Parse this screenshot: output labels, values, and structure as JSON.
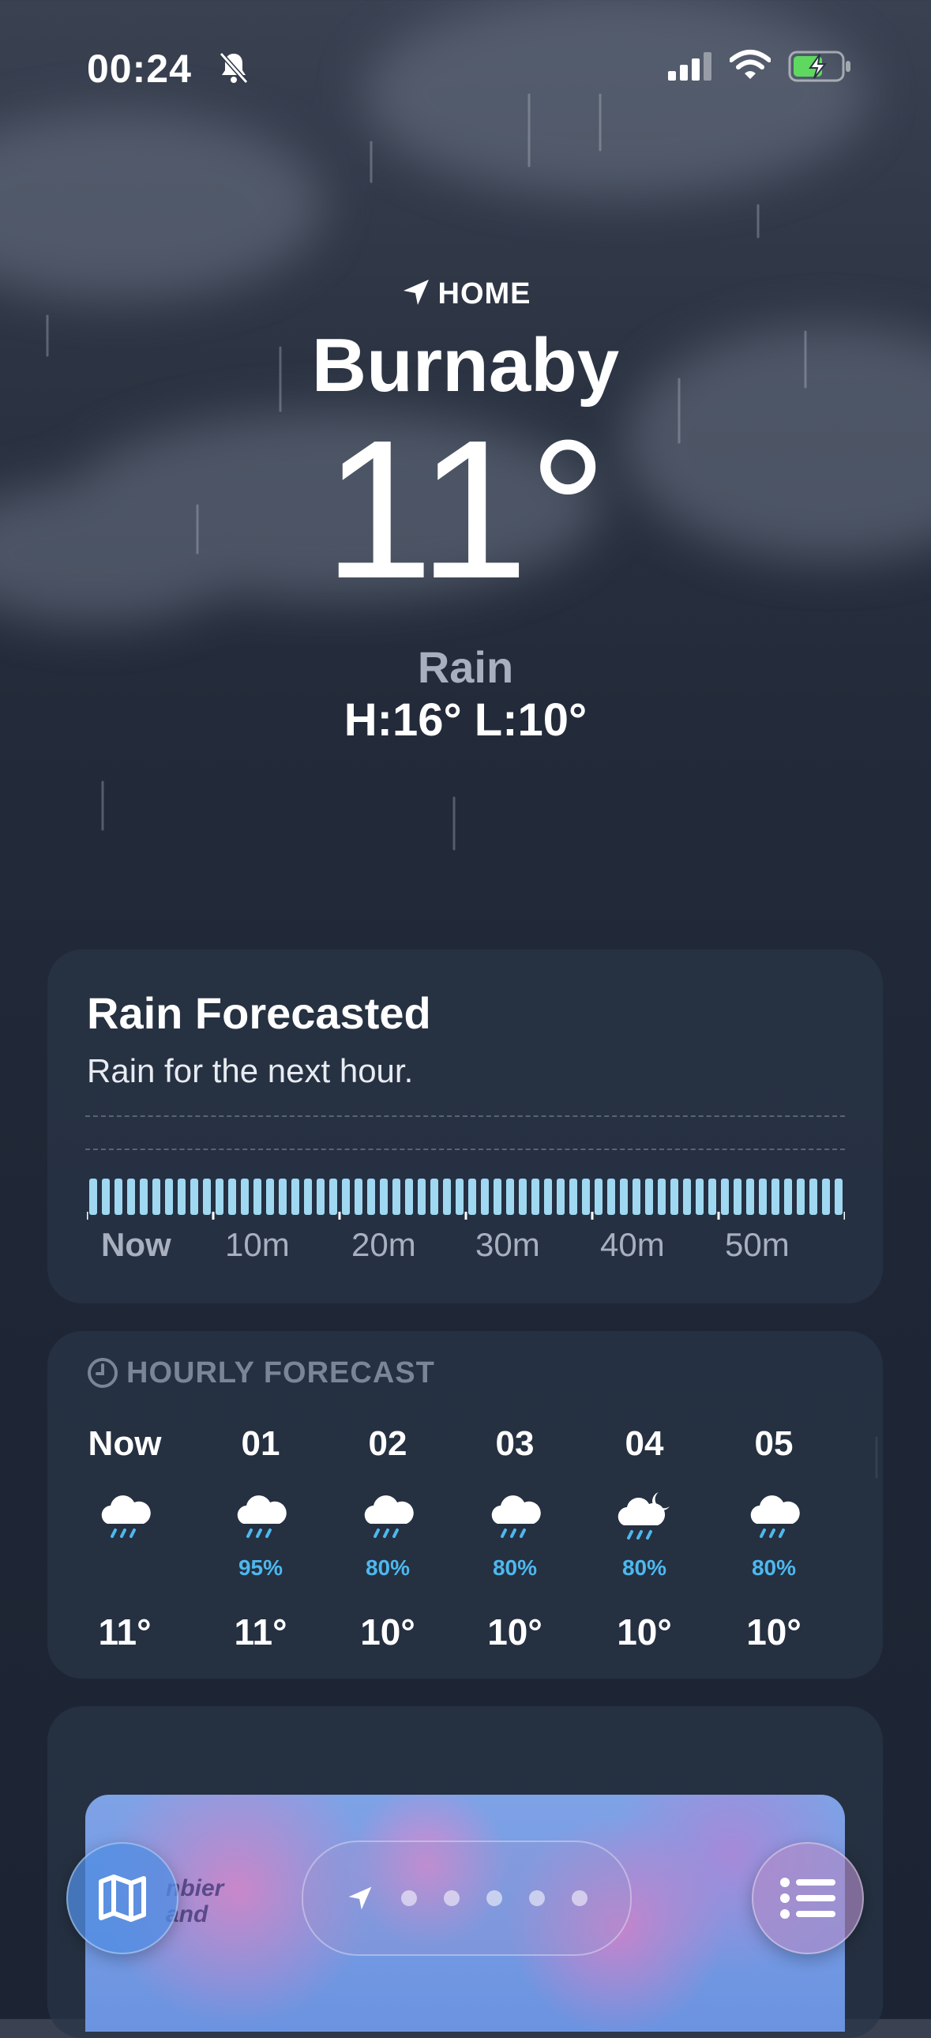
{
  "status_bar": {
    "time": "00:24",
    "icons": [
      "bell-slash-icon",
      "cellular-signal-icon",
      "wifi-icon",
      "battery-charging-icon"
    ],
    "battery_color": "#5fd860"
  },
  "header": {
    "location_tag": "HOME",
    "city": "Burnaby",
    "temperature": "11°",
    "condition": "Rain",
    "high_low": "H:16°  L:10°"
  },
  "rain_card": {
    "title": "Rain Forecasted",
    "subtitle": "Rain for the next hour.",
    "timeline_labels": [
      "Now",
      "10m",
      "20m",
      "30m",
      "40m",
      "50m"
    ],
    "bar_color": "#9fd8f0",
    "chart_data": {
      "type": "bar",
      "title": "",
      "xlabel": "",
      "ylabel": "",
      "intensity_uniform": true
    }
  },
  "hourly": {
    "header": "HOURLY FORECAST",
    "items": [
      {
        "time": "Now",
        "icon": "cloud-rain-icon",
        "pct": "",
        "temp": "11°"
      },
      {
        "time": "01",
        "icon": "cloud-rain-icon",
        "pct": "95%",
        "temp": "11°"
      },
      {
        "time": "02",
        "icon": "cloud-rain-icon",
        "pct": "80%",
        "temp": "10°"
      },
      {
        "time": "03",
        "icon": "cloud-rain-icon",
        "pct": "80%",
        "temp": "10°"
      },
      {
        "time": "04",
        "icon": "cloud-moon-rain-icon",
        "pct": "80%",
        "temp": "10°"
      },
      {
        "time": "05",
        "icon": "cloud-rain-icon",
        "pct": "80%",
        "temp": "10°"
      }
    ],
    "accent": "#4db8ee"
  },
  "map_card": {
    "map_label": "nbier\nand"
  },
  "toolbar": {
    "map_button": "map-icon",
    "pager_dots": 5,
    "list_button": "list-icon"
  }
}
